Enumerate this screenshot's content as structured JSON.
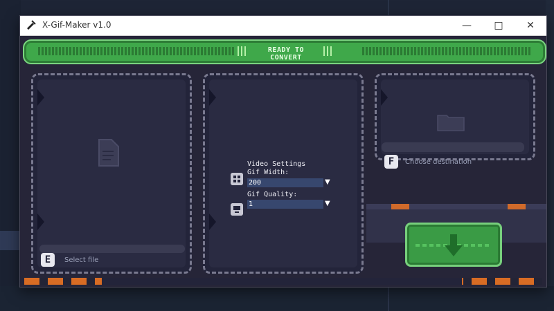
{
  "window": {
    "title": "X-Gif-Maker v1.0",
    "controls": {
      "minimize": "—",
      "maximize": "□",
      "close": "✕"
    }
  },
  "status": {
    "text": "READY TO CONVERT"
  },
  "input_panel": {
    "key": "E",
    "label": "Select file"
  },
  "settings_panel": {
    "title": "Video Settings",
    "width_label": "Gif Width:",
    "width_value": "200",
    "quality_label": "Gif Quality:",
    "quality_value": "1"
  },
  "output_panel": {
    "key": "F",
    "label": "Choose destination"
  },
  "colors": {
    "accent_green": "#3fa84a",
    "panel_bg": "#23243a",
    "hazard_orange": "#d86c24"
  },
  "icons": [
    "app-icon",
    "file-icon",
    "folder-icon",
    "grid-icon",
    "image-icon",
    "download-arrow-icon"
  ]
}
